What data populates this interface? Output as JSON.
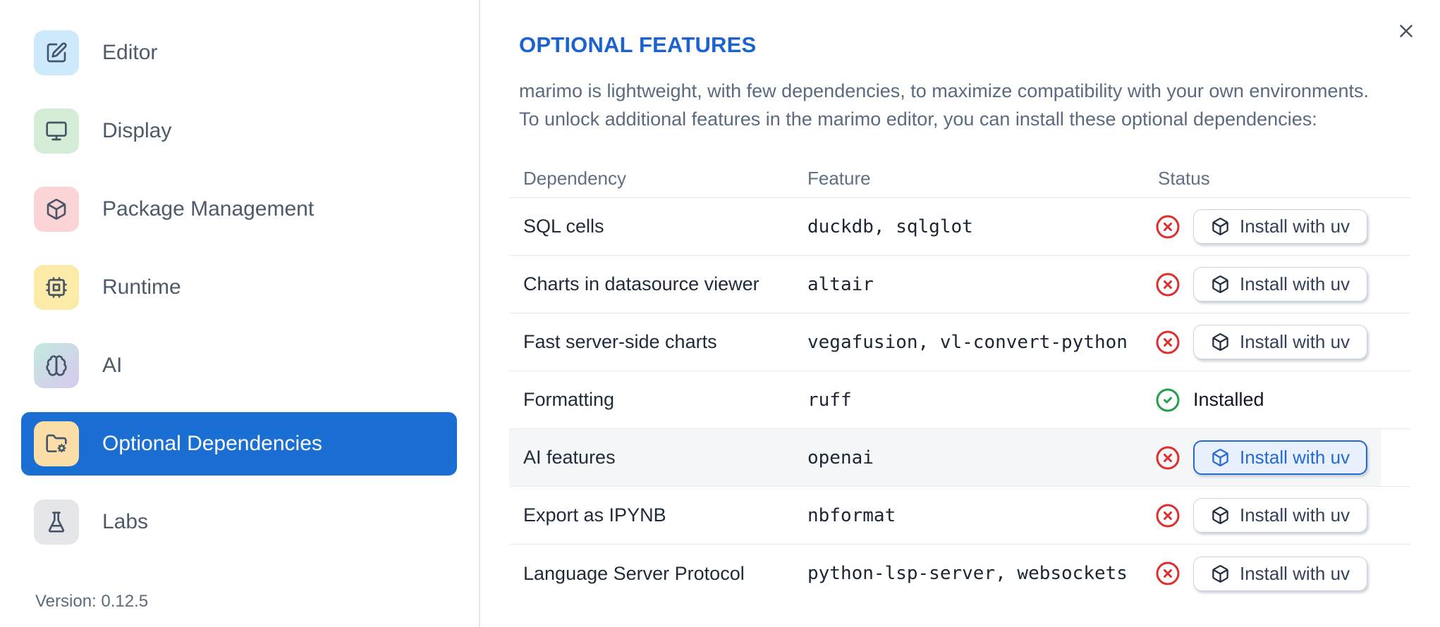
{
  "colors": {
    "accent": "#1b6fd3",
    "title_blue": "#1a63d0",
    "link_blue": "#2569d2",
    "error_red": "#dc2f2f",
    "success_green": "#1fa04a",
    "tile_editor": "#cde9fb",
    "tile_display": "#d5ecd6",
    "tile_package": "#fbd5d5",
    "tile_runtime": "#fceaa8",
    "tile_ai_start": "#c3e9de",
    "tile_ai_end": "#d8c9ef",
    "tile_optional": "#fcdfa8",
    "tile_labs": "#e5e6e8"
  },
  "sidebar": {
    "items": [
      {
        "label": "Editor",
        "icon": "editor-icon",
        "selected": false
      },
      {
        "label": "Display",
        "icon": "display-icon",
        "selected": false
      },
      {
        "label": "Package Management",
        "icon": "package-management-icon",
        "selected": false
      },
      {
        "label": "Runtime",
        "icon": "runtime-icon",
        "selected": false
      },
      {
        "label": "AI",
        "icon": "ai-icon",
        "selected": false
      },
      {
        "label": "Optional Dependencies",
        "icon": "optional-dependencies-icon",
        "selected": true
      },
      {
        "label": "Labs",
        "icon": "labs-icon",
        "selected": false
      }
    ],
    "version": "Version: 0.12.5"
  },
  "panel": {
    "title": "OPTIONAL FEATURES",
    "description_lines": [
      "marimo is lightweight, with few dependencies, to maximize compatibility with your own environments.",
      "To unlock additional features in the marimo editor, you can install these optional dependencies:"
    ]
  },
  "table": {
    "headers": [
      "Dependency",
      "Feature",
      "Status"
    ],
    "install_button_label": "Install with uv",
    "installed_label": "Installed",
    "rows": [
      {
        "dependency": "SQL cells",
        "feature": "duckdb, sqlglot",
        "status": "not_installed",
        "highlighted": false
      },
      {
        "dependency": "Charts in datasource viewer",
        "feature": "altair",
        "status": "not_installed",
        "highlighted": false
      },
      {
        "dependency": "Fast server-side charts",
        "feature": "vegafusion, vl-convert-python",
        "status": "not_installed",
        "highlighted": false
      },
      {
        "dependency": "Formatting",
        "feature": "ruff",
        "status": "installed",
        "highlighted": false
      },
      {
        "dependency": "AI features",
        "feature": "openai",
        "status": "not_installed",
        "highlighted": true
      },
      {
        "dependency": "Export as IPYNB",
        "feature": "nbformat",
        "status": "not_installed",
        "highlighted": false
      },
      {
        "dependency": "Language Server Protocol",
        "feature": "python-lsp-server, websockets",
        "status": "not_installed",
        "highlighted": false
      }
    ]
  }
}
